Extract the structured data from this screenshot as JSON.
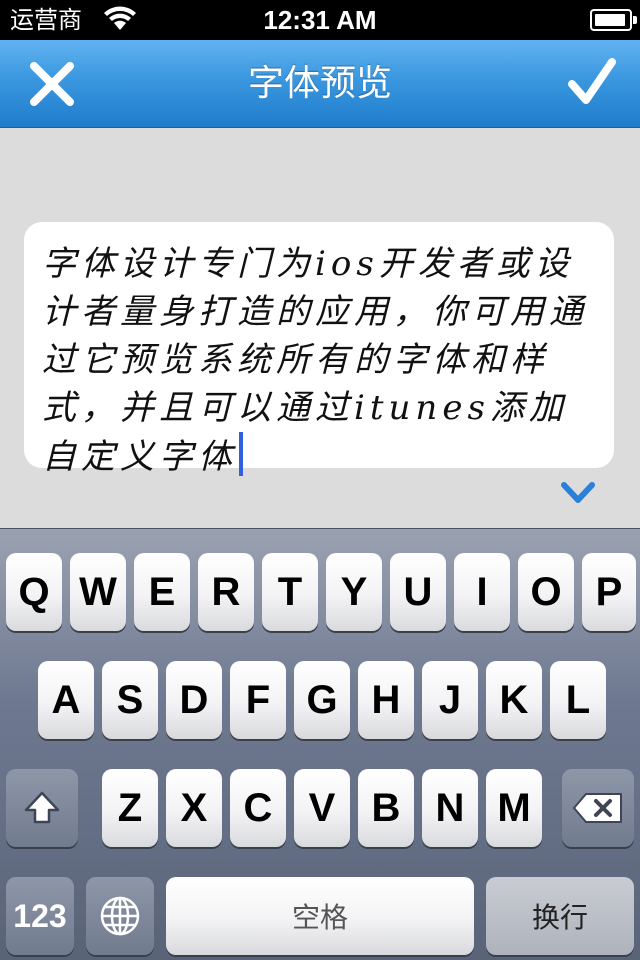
{
  "status_bar": {
    "carrier": "运营商",
    "time": "12:31 AM",
    "wifi_icon": "wifi-icon",
    "battery_icon": "battery-icon"
  },
  "nav": {
    "title": "字体预览",
    "close_icon": "close-icon",
    "done_icon": "checkmark-icon",
    "accent_color": "#3a97df"
  },
  "editor": {
    "text": "字体设计专门为ios开发者或设计者量身打造的应用，你可用通过它预览系统所有的字体和样式，并且可以通过itunes添加自定义字体",
    "caret_color": "#3060e0",
    "collapse_icon": "chevron-down-icon"
  },
  "keyboard": {
    "row1": [
      "Q",
      "W",
      "E",
      "R",
      "T",
      "Y",
      "U",
      "I",
      "O",
      "P"
    ],
    "row2": [
      "A",
      "S",
      "D",
      "F",
      "G",
      "H",
      "J",
      "K",
      "L"
    ],
    "row3": [
      "Z",
      "X",
      "C",
      "V",
      "B",
      "N",
      "M"
    ],
    "shift_icon": "shift-icon",
    "delete_icon": "delete-icon",
    "num_label": "123",
    "globe_icon": "globe-icon",
    "space_label": "空格",
    "return_label": "换行"
  }
}
